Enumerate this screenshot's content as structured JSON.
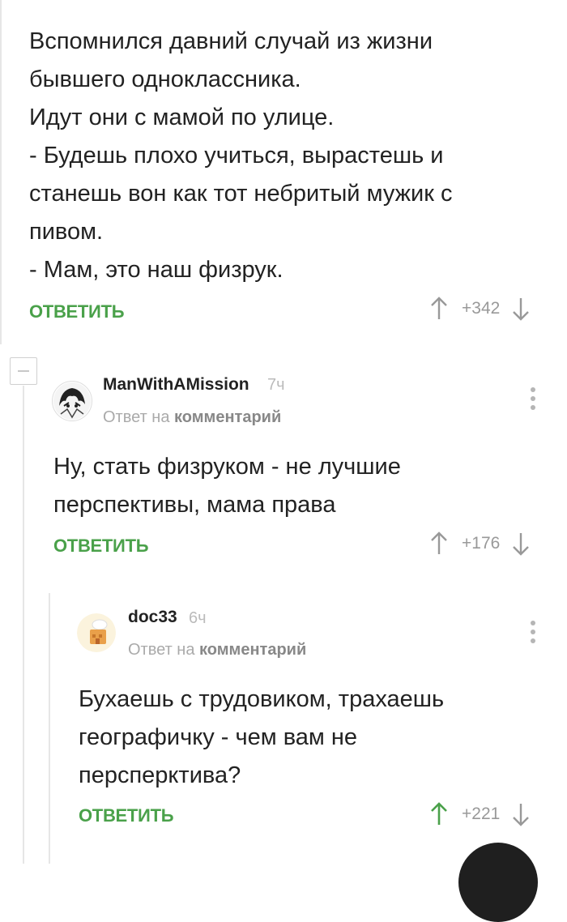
{
  "comment1": {
    "lines": [
      "Вспомнился давний случай из жизни",
      "бывшего одноклассника.",
      "Идут они с мамой по улице.",
      "- Будешь плохо учиться, вырастешь и",
      "станешь вон как тот небритый мужик с",
      "пивом.",
      "- Мам, это наш физрук."
    ],
    "reply_label": "ОТВЕТИТЬ",
    "score": "+342"
  },
  "comment2": {
    "username": "ManWithAMission",
    "time": "7ч",
    "reply_to_prefix": "Ответ на",
    "reply_to_link": "комментарий",
    "lines": [
      "Ну, стать физруком - не лучшие",
      "перспективы, мама права"
    ],
    "reply_label": "ОТВЕТИТЬ",
    "score": "+176"
  },
  "comment3": {
    "username": "doc33",
    "time": "6ч",
    "reply_to_prefix": "Ответ на",
    "reply_to_link": "комментарий",
    "lines": [
      "Бухаешь с трудовиком, трахаешь",
      "географичку - чем вам не",
      "персперктива?"
    ],
    "reply_label": "ОТВЕТИТЬ",
    "score": "+221"
  },
  "colors": {
    "accent": "#4aa14a",
    "muted": "#999999",
    "text": "#222222",
    "upvoted": "#4aa14a"
  },
  "icons": {
    "upvote": "arrow-up-icon",
    "downvote": "arrow-down-icon",
    "more": "more-vertical-icon",
    "collapse": "minus-icon"
  }
}
